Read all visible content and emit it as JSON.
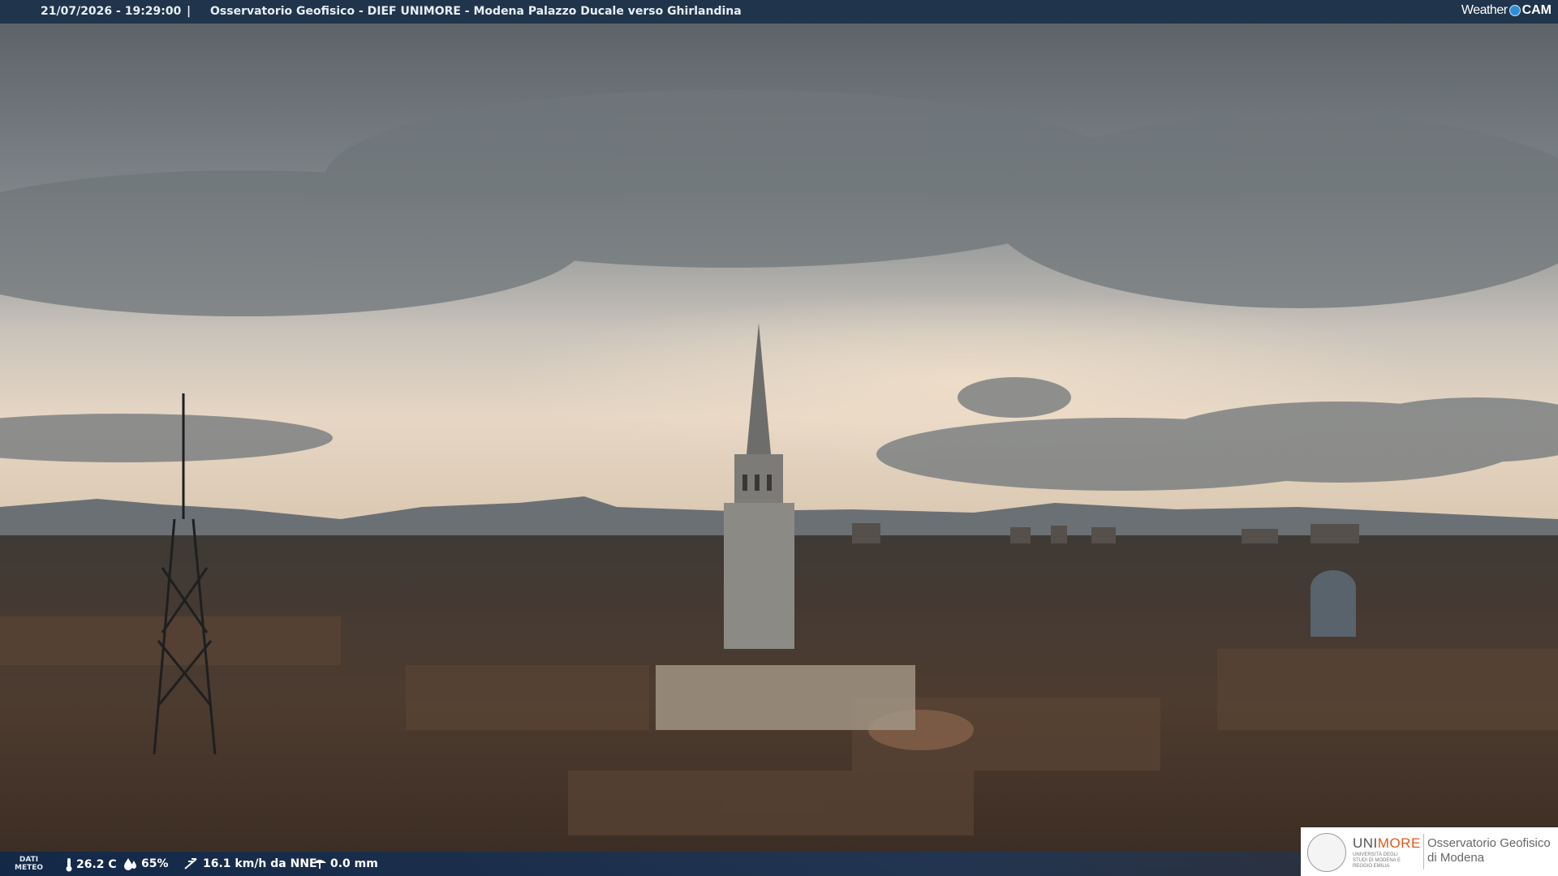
{
  "header": {
    "timestamp": "21/07/2026 - 19:29:00",
    "separator": "|",
    "title": "Osservatorio Geofisico - DIEF UNIMORE - Modena Palazzo Ducale verso Ghirlandina"
  },
  "brand": {
    "weather": "Weather",
    "cam": "CAM",
    "accent": "#2f8fd6"
  },
  "weather_data": {
    "label_line1": "DATI",
    "label_line2": "METEO",
    "temperature": "26.2 C",
    "humidity": "65%",
    "wind": "16.1 km/h da NNE",
    "rain": "0.0 mm",
    "icons": [
      "thermometer-icon",
      "humidity-icon",
      "wind-icon",
      "rain-gauge-icon"
    ]
  },
  "logo": {
    "uni": "UNI",
    "more": "MORE",
    "subtitle": "UNIVERSITÀ DEGLI STUDI DI MODENA E REGGIO EMILIA",
    "observatory_line1": "Osservatorio Geofisico",
    "observatory_line2": "di Modena"
  },
  "colors": {
    "sky_top": "#5f666b",
    "sky_glow": "#e9d9c6",
    "roofs": "#4a3a2e",
    "bar": "#162d46"
  }
}
